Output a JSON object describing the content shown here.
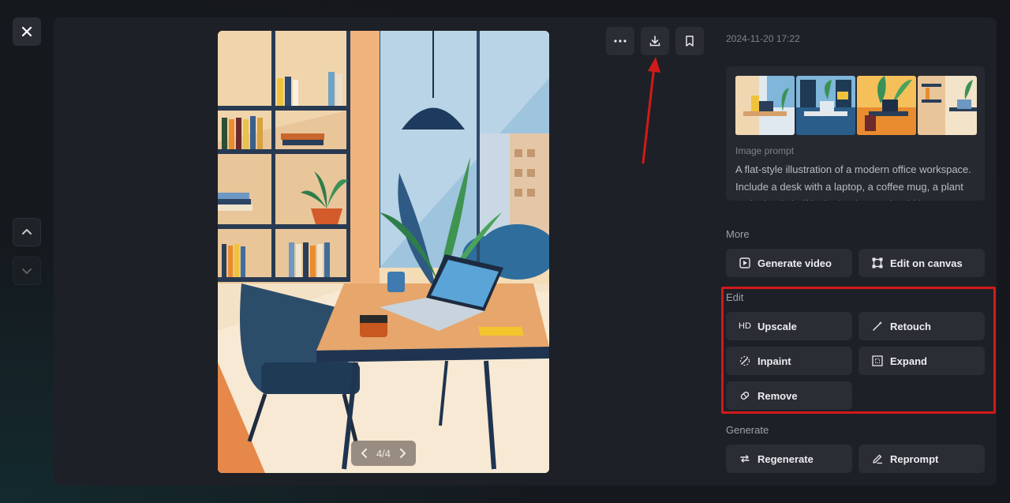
{
  "timestamp": "2024-11-20 17:22",
  "pager": {
    "text": "4/4"
  },
  "prompt": {
    "label": "Image prompt",
    "text": "A flat-style illustration of a modern office workspace. Include a desk with a laptop, a coffee mug, a plant and a bookshelf in the background. Add large"
  },
  "sections": {
    "more": "More",
    "edit": "Edit",
    "generate": "Generate"
  },
  "buttons": {
    "generate_video": "Generate video",
    "edit_on_canvas": "Edit on canvas",
    "upscale": "Upscale",
    "upscale_icon_text": "HD",
    "retouch": "Retouch",
    "inpaint": "Inpaint",
    "expand": "Expand",
    "remove": "Remove",
    "regenerate": "Regenerate",
    "reprompt": "Reprompt"
  },
  "colors": {
    "highlight": "#d11a1a",
    "annotation_arrow": "#d11a1a"
  }
}
